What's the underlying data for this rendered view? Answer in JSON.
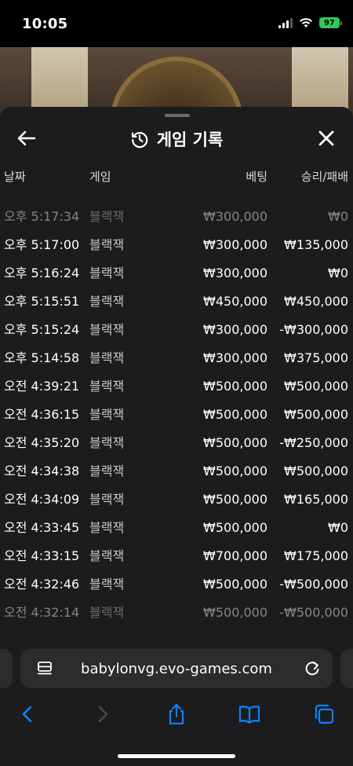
{
  "status_bar": {
    "time": "10:05",
    "battery": "97"
  },
  "modal": {
    "title": "게임 기록",
    "columns": {
      "date": "날짜",
      "game": "게임",
      "bet": "베팅",
      "win_loss": "승리/패배"
    },
    "rows": [
      {
        "date": "오후 5:17:34",
        "game": "블랙잭",
        "bet": "₩300,000",
        "result": "₩0",
        "state": "faded"
      },
      {
        "date": "오후 5:17:00",
        "game": "블랙잭",
        "bet": "₩300,000",
        "result": "₩135,000",
        "state": "normal"
      },
      {
        "date": "오후 5:16:24",
        "game": "블랙잭",
        "bet": "₩300,000",
        "result": "₩0",
        "state": "normal"
      },
      {
        "date": "오후 5:15:51",
        "game": "블랙잭",
        "bet": "₩450,000",
        "result": "₩450,000",
        "state": "normal"
      },
      {
        "date": "오후 5:15:24",
        "game": "블랙잭",
        "bet": "₩300,000",
        "result": "-₩300,000",
        "state": "normal"
      },
      {
        "date": "오후 5:14:58",
        "game": "블랙잭",
        "bet": "₩300,000",
        "result": "₩375,000",
        "state": "normal"
      },
      {
        "date": "오전 4:39:21",
        "game": "블랙잭",
        "bet": "₩500,000",
        "result": "₩500,000",
        "state": "normal"
      },
      {
        "date": "오전 4:36:15",
        "game": "블랙잭",
        "bet": "₩500,000",
        "result": "₩500,000",
        "state": "normal"
      },
      {
        "date": "오전 4:35:20",
        "game": "블랙잭",
        "bet": "₩500,000",
        "result": "-₩250,000",
        "state": "normal"
      },
      {
        "date": "오전 4:34:38",
        "game": "블랙잭",
        "bet": "₩500,000",
        "result": "₩500,000",
        "state": "normal"
      },
      {
        "date": "오전 4:34:09",
        "game": "블랙잭",
        "bet": "₩500,000",
        "result": "₩165,000",
        "state": "normal"
      },
      {
        "date": "오전 4:33:45",
        "game": "블랙잭",
        "bet": "₩500,000",
        "result": "₩0",
        "state": "normal"
      },
      {
        "date": "오전 4:33:15",
        "game": "블랙잭",
        "bet": "₩700,000",
        "result": "₩175,000",
        "state": "normal"
      },
      {
        "date": "오전 4:32:46",
        "game": "블랙잭",
        "bet": "₩500,000",
        "result": "-₩500,000",
        "state": "normal"
      },
      {
        "date": "오전 4:32:14",
        "game": "블랙잭",
        "bet": "₩500,000",
        "result": "-₩500,000",
        "state": "faded"
      }
    ]
  },
  "browser": {
    "url": "babylonvg.evo-games.com"
  },
  "icons": {
    "back": "arrow-left-icon",
    "close": "close-icon",
    "history": "history-icon",
    "reader": "reader-icon",
    "reload": "reload-icon",
    "nav_back": "chevron-left-icon",
    "nav_forward": "chevron-right-icon",
    "share": "share-icon",
    "bookmarks": "book-icon",
    "tabs": "tabs-icon"
  },
  "colors": {
    "panel_bg": "#1c1c1e",
    "accent_blue": "#0a84ff",
    "battery_green": "#34c759"
  }
}
